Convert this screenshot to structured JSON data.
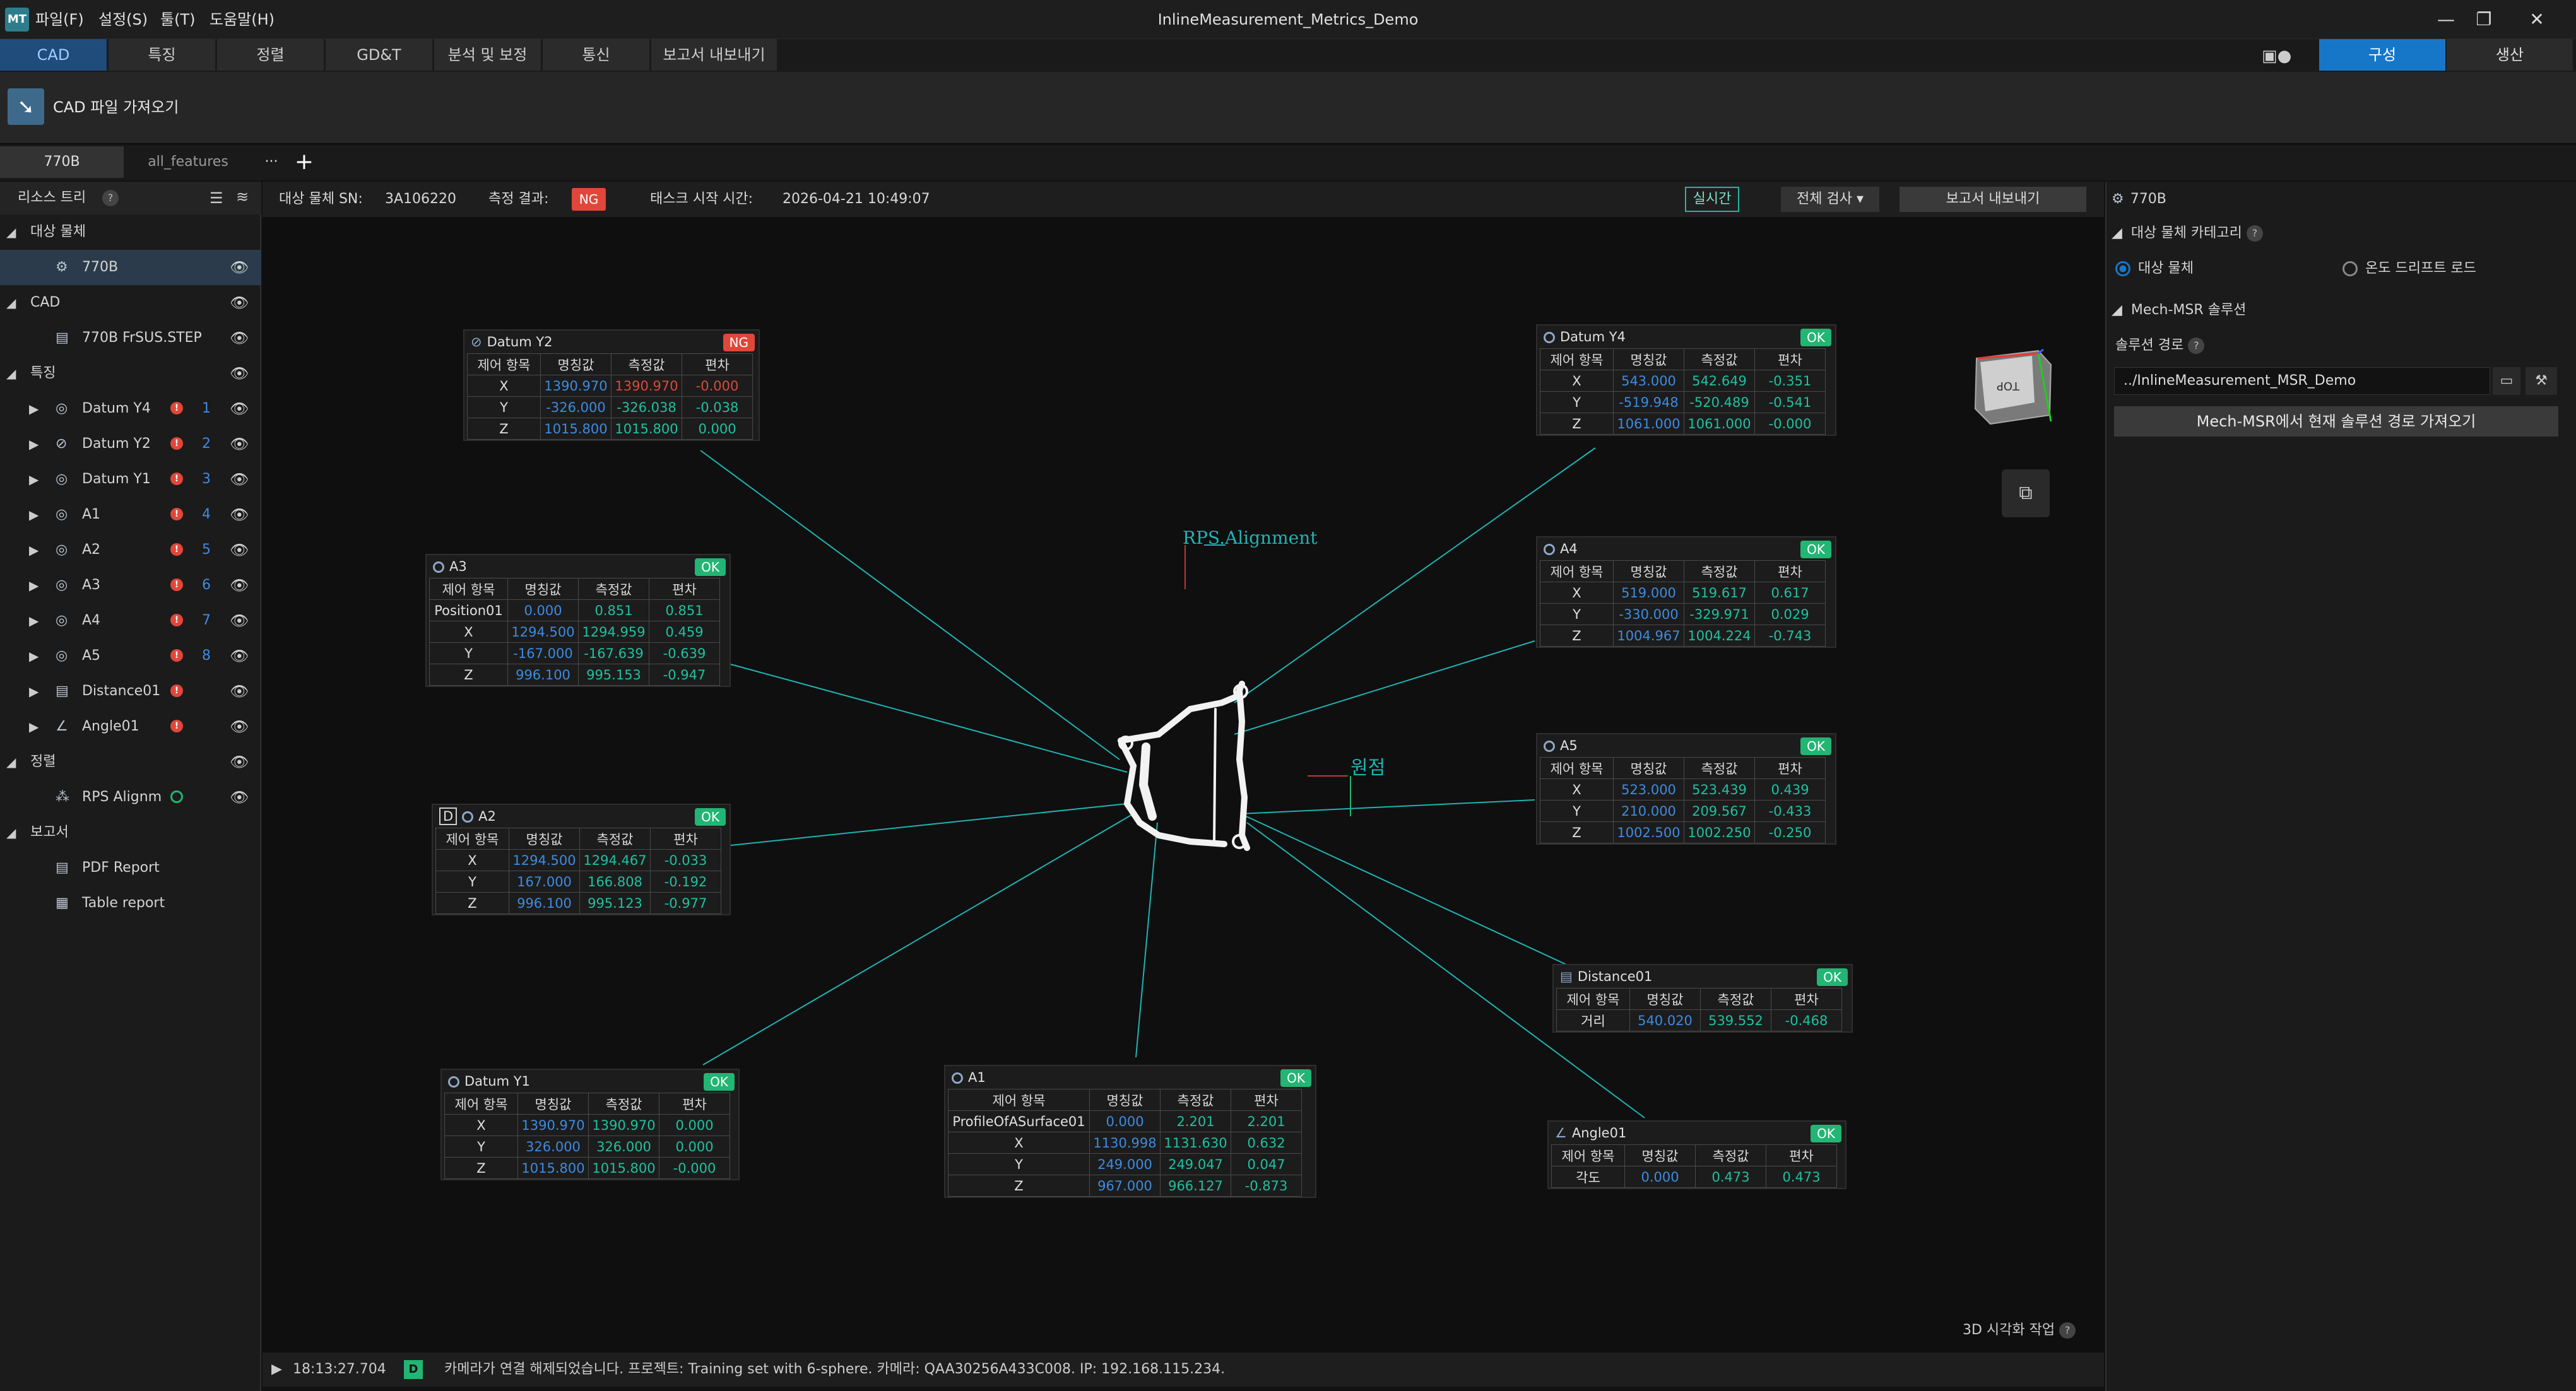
{
  "app": {
    "title": "InlineMeasurement_Metrics_Demo",
    "logo_text": "MT",
    "menu": [
      "파일(F)",
      "설정(S)",
      "툴(T)",
      "도움말(H)"
    ],
    "window_controls": {
      "minimize": "—",
      "restore": "❐",
      "close": "✕"
    }
  },
  "main_tabs": [
    "CAD",
    "특징",
    "정렬",
    "GD&T",
    "분석 및 보정",
    "통신",
    "보고서 내보내기"
  ],
  "mode_buttons": {
    "configure": "구성",
    "production": "생산"
  },
  "toolbar": {
    "import_cad": "CAD 파일 가져오기"
  },
  "project_tabs": {
    "tabs": [
      "770B",
      "all_features"
    ],
    "more": "···",
    "add": "+"
  },
  "resource_tree": {
    "title": "리소스 트리",
    "sections": {
      "target": "대상 물체",
      "cad": "CAD",
      "features": "특징",
      "alignment": "정렬",
      "report": "보고서"
    },
    "target_item": "770B",
    "cad_item": "770B FrSUS.STEP",
    "feature_items": [
      {
        "label": "Datum Y4",
        "num": "1"
      },
      {
        "label": "Datum Y2",
        "num": "2"
      },
      {
        "label": "Datum Y1",
        "num": "3"
      },
      {
        "label": "A1",
        "num": "4"
      },
      {
        "label": "A2",
        "num": "5"
      },
      {
        "label": "A3",
        "num": "6"
      },
      {
        "label": "A4",
        "num": "7"
      },
      {
        "label": "A5",
        "num": "8"
      },
      {
        "label": "Distance01",
        "num": ""
      },
      {
        "label": "Angle01",
        "num": ""
      }
    ],
    "alignment_item": "RPS Alignm",
    "report_items": [
      "PDF Report",
      "Table report"
    ]
  },
  "viewport_bar": {
    "sn_label": "대상 물체 SN:",
    "sn_value": "3A106220",
    "result_label": "측정 결과:",
    "result_value": "NG",
    "start_label": "태스크 시작 시간:",
    "start_value": "2026-04-21 10:49:07",
    "realtime": "실시간",
    "full_check": "전체 검사",
    "export": "보고서 내보내기"
  },
  "scene": {
    "alignment_label": "RPS.Alignment",
    "origin_label": "원점",
    "cube_face": "TOP",
    "viz_task": "3D 시각화 작업"
  },
  "cards_headers": [
    "제어 항목",
    "명칭값",
    "측정값",
    "편차"
  ],
  "cards": {
    "datum_y2": {
      "title": "Datum Y2",
      "status": "NG",
      "rows": [
        [
          "X",
          "1390.970",
          "1390.970",
          "-0.000"
        ],
        [
          "Y",
          "-326.000",
          "-326.038",
          "-0.038"
        ],
        [
          "Z",
          "1015.800",
          "1015.800",
          "0.000"
        ]
      ]
    },
    "datum_y4": {
      "title": "Datum Y4",
      "status": "OK",
      "rows": [
        [
          "X",
          "543.000",
          "542.649",
          "-0.351"
        ],
        [
          "Y",
          "-519.948",
          "-520.489",
          "-0.541"
        ],
        [
          "Z",
          "1061.000",
          "1061.000",
          "-0.000"
        ]
      ]
    },
    "a3": {
      "title": "A3",
      "status": "OK",
      "rows": [
        [
          "Position01",
          "0.000",
          "0.851",
          "0.851"
        ],
        [
          "X",
          "1294.500",
          "1294.959",
          "0.459"
        ],
        [
          "Y",
          "-167.000",
          "-167.639",
          "-0.639"
        ],
        [
          "Z",
          "996.100",
          "995.153",
          "-0.947"
        ]
      ]
    },
    "a4": {
      "title": "A4",
      "status": "OK",
      "rows": [
        [
          "X",
          "519.000",
          "519.617",
          "0.617"
        ],
        [
          "Y",
          "-330.000",
          "-329.971",
          "0.029"
        ],
        [
          "Z",
          "1004.967",
          "1004.224",
          "-0.743"
        ]
      ]
    },
    "a2": {
      "title": "A2",
      "status": "OK",
      "tag": "D",
      "rows": [
        [
          "X",
          "1294.500",
          "1294.467",
          "-0.033"
        ],
        [
          "Y",
          "167.000",
          "166.808",
          "-0.192"
        ],
        [
          "Z",
          "996.100",
          "995.123",
          "-0.977"
        ]
      ]
    },
    "a5": {
      "title": "A5",
      "status": "OK",
      "rows": [
        [
          "X",
          "523.000",
          "523.439",
          "0.439"
        ],
        [
          "Y",
          "210.000",
          "209.567",
          "-0.433"
        ],
        [
          "Z",
          "1002.500",
          "1002.250",
          "-0.250"
        ]
      ]
    },
    "distance01": {
      "title": "Distance01",
      "status": "OK",
      "rows": [
        [
          "거리",
          "540.020",
          "539.552",
          "-0.468"
        ]
      ]
    },
    "datum_y1": {
      "title": "Datum Y1",
      "status": "OK",
      "rows": [
        [
          "X",
          "1390.970",
          "1390.970",
          "0.000"
        ],
        [
          "Y",
          "326.000",
          "326.000",
          "0.000"
        ],
        [
          "Z",
          "1015.800",
          "1015.800",
          "-0.000"
        ]
      ]
    },
    "a1": {
      "title": "A1",
      "status": "OK",
      "rows": [
        [
          "ProfileOfASurface01",
          "0.000",
          "2.201",
          "2.201"
        ],
        [
          "X",
          "1130.998",
          "1131.630",
          "0.632"
        ],
        [
          "Y",
          "249.000",
          "249.047",
          "0.047"
        ],
        [
          "Z",
          "967.000",
          "966.127",
          "-0.873"
        ]
      ]
    },
    "angle01": {
      "title": "Angle01",
      "status": "OK",
      "rows": [
        [
          "각도",
          "0.000",
          "0.473",
          "0.473"
        ]
      ]
    }
  },
  "right_panel": {
    "header": "770B",
    "category_title": "대상 물체 카테고리",
    "opt_target": "대상 물체",
    "opt_drift": "온도 드리프트 로드",
    "msr_title": "Mech-MSR 솔루션",
    "path_label": "솔루션 경로",
    "path_value": "../InlineMeasurement_MSR_Demo",
    "fetch_button": "Mech-MSR에서 현재 솔루션 경로 가져오기"
  },
  "status_bar": {
    "time": "18:13:27.704",
    "level": "D",
    "message": "카메라가 연결 해제되었습니다. 프로젝트: Training set with 6-sphere. 카메라: QAA30256A433C008. IP: 192.168.115.234."
  },
  "colors": {
    "accent": "#1677c9",
    "ok": "#22b573",
    "ng": "#e0473a",
    "nominal": "#3d8be0",
    "measured": "#20c0a0",
    "leader": "#1fb3b3"
  }
}
